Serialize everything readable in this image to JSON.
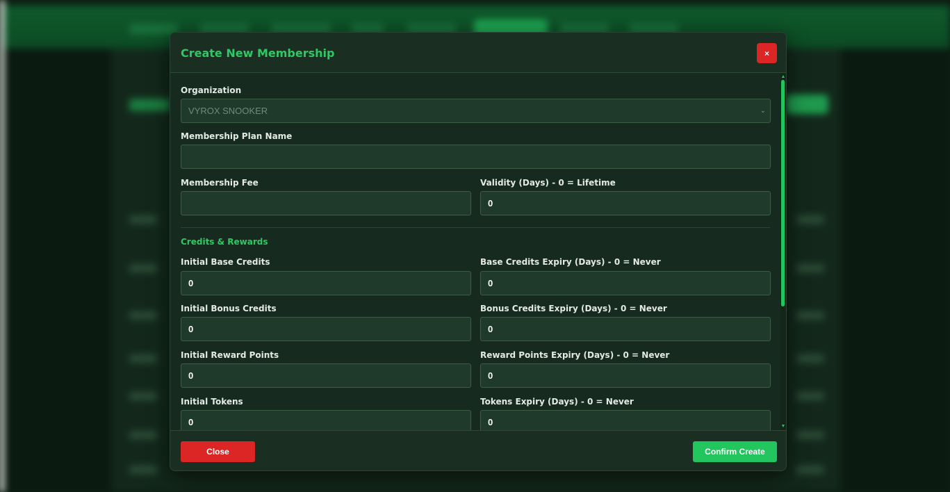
{
  "modal": {
    "title": "Create New Membership",
    "close_icon": "×"
  },
  "form": {
    "organization": {
      "label": "Organization",
      "value": "VYROX SNOOKER",
      "chevron": "⌄"
    },
    "plan_name": {
      "label": "Membership Plan Name",
      "value": ""
    },
    "fee": {
      "label": "Membership Fee",
      "value": ""
    },
    "validity": {
      "label": "Validity (Days) - 0 = Lifetime",
      "value": "0"
    },
    "credits_section_title": "Credits & Rewards",
    "base_credits": {
      "label": "Initial Base Credits",
      "value": "0"
    },
    "base_credits_expiry": {
      "label": "Base Credits Expiry (Days) - 0 = Never",
      "value": "0"
    },
    "bonus_credits": {
      "label": "Initial Bonus Credits",
      "value": "0"
    },
    "bonus_credits_expiry": {
      "label": "Bonus Credits Expiry (Days) - 0 = Never",
      "value": "0"
    },
    "reward_points": {
      "label": "Initial Reward Points",
      "value": "0"
    },
    "reward_points_expiry": {
      "label": "Reward Points Expiry (Days) - 0 = Never",
      "value": "0"
    },
    "tokens": {
      "label": "Initial Tokens",
      "value": "0"
    },
    "tokens_expiry": {
      "label": "Tokens Expiry (Days) - 0 = Never",
      "value": "0"
    }
  },
  "footer": {
    "close_label": "Close",
    "confirm_label": "Confirm Create"
  },
  "scrollbar": {
    "up_arrow": "▲",
    "down_arrow": "▼",
    "scroll_position": 0
  },
  "colors": {
    "accent_green": "#22c55e",
    "title_green": "#2fc864",
    "danger_red": "#dc2626",
    "modal_bg": "#172a1f",
    "field_bg": "#1f3a2a"
  }
}
